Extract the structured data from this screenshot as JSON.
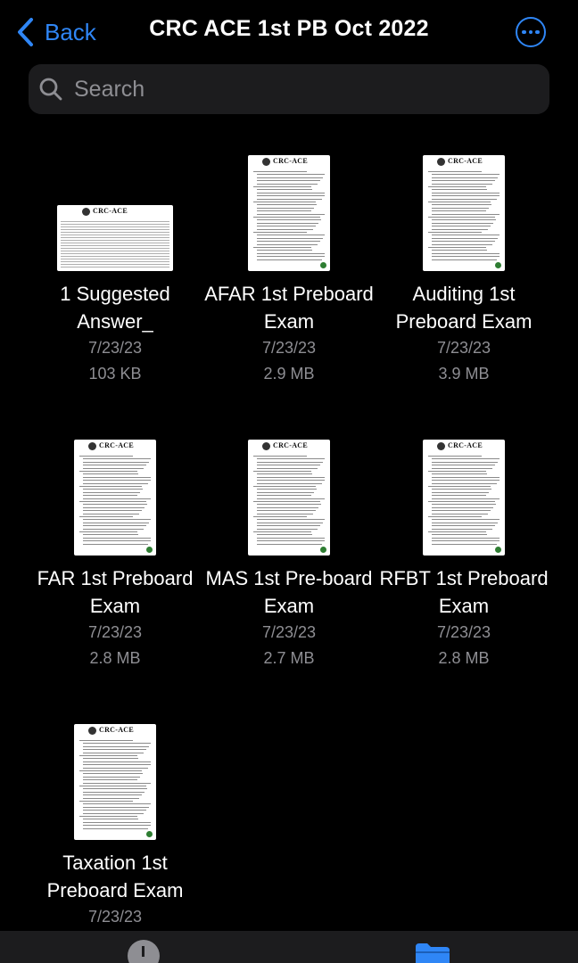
{
  "nav": {
    "back_label": "Back",
    "title": "CRC ACE 1st PB Oct 2022",
    "more_icon": "ellipsis-circle-icon"
  },
  "search": {
    "placeholder": "Search"
  },
  "thumbnail": {
    "brand": "CRC-ACE"
  },
  "files": [
    {
      "name": "1 Suggested Answer_",
      "date": "7/23/23",
      "size": "103 KB",
      "orientation": "landscape"
    },
    {
      "name": "AFAR 1st Preboard Exam",
      "date": "7/23/23",
      "size": "2.9 MB",
      "orientation": "portrait"
    },
    {
      "name": "Auditing 1st Preboard Exam",
      "date": "7/23/23",
      "size": "3.9 MB",
      "orientation": "portrait"
    },
    {
      "name": "FAR 1st Preboard Exam",
      "date": "7/23/23",
      "size": "2.8 MB",
      "orientation": "portrait"
    },
    {
      "name": "MAS 1st Pre-board Exam",
      "date": "7/23/23",
      "size": "2.7 MB",
      "orientation": "portrait"
    },
    {
      "name": "RFBT 1st Preboard Exam",
      "date": "7/23/23",
      "size": "2.8 MB",
      "orientation": "portrait"
    },
    {
      "name": "Taxation 1st Preboard Exam",
      "date": "7/23/23",
      "size": "",
      "orientation": "portrait"
    }
  ],
  "tabbar": {
    "recents_icon": "clock-icon",
    "browse_icon": "folder-icon"
  },
  "colors": {
    "accent": "#2f86f6",
    "background": "#000000",
    "secondary_text": "#8e8e93",
    "field_bg": "#1c1c1e"
  }
}
